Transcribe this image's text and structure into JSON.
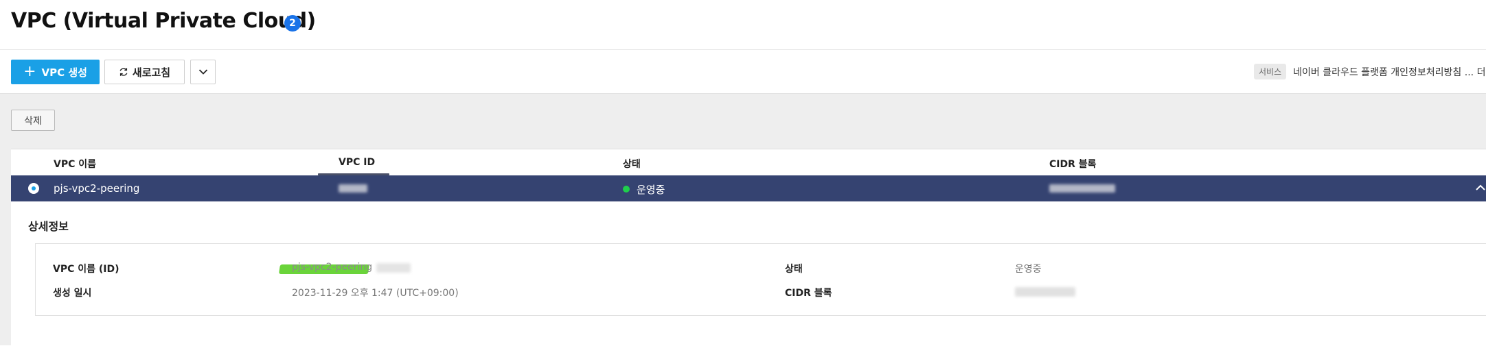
{
  "header": {
    "title": "VPC (Virtual Private Cloud)",
    "count": "2"
  },
  "toolbar": {
    "create_label": "VPC 생성",
    "refresh_label": "새로고침",
    "notice_tag": "서비스",
    "notice_text": "네이버 클라우드 플랫폼 개인정보처리방침 ...  더"
  },
  "actions": {
    "delete_label": "삭제"
  },
  "table": {
    "columns": [
      "VPC 이름",
      "VPC ID",
      "상태",
      "CIDR 블록"
    ],
    "rows": [
      {
        "name": "pjs-vpc2-peering",
        "status": "운영중"
      }
    ]
  },
  "details": {
    "title": "상세정보",
    "labels": {
      "vpc_name_id": "VPC 이름 (ID)",
      "created_at": "생성 일시",
      "status": "상태",
      "cidr": "CIDR 블록"
    },
    "values": {
      "vpc_name": "pjs-vpc2-peering",
      "created_at": "2023-11-29 오후 1:47 (UTC+09:00)",
      "status": "운영중"
    }
  },
  "colors": {
    "primary": "#1aa0e6",
    "selected_row": "#354371",
    "status_running": "#1fce4c",
    "badge": "#1a73e8"
  }
}
